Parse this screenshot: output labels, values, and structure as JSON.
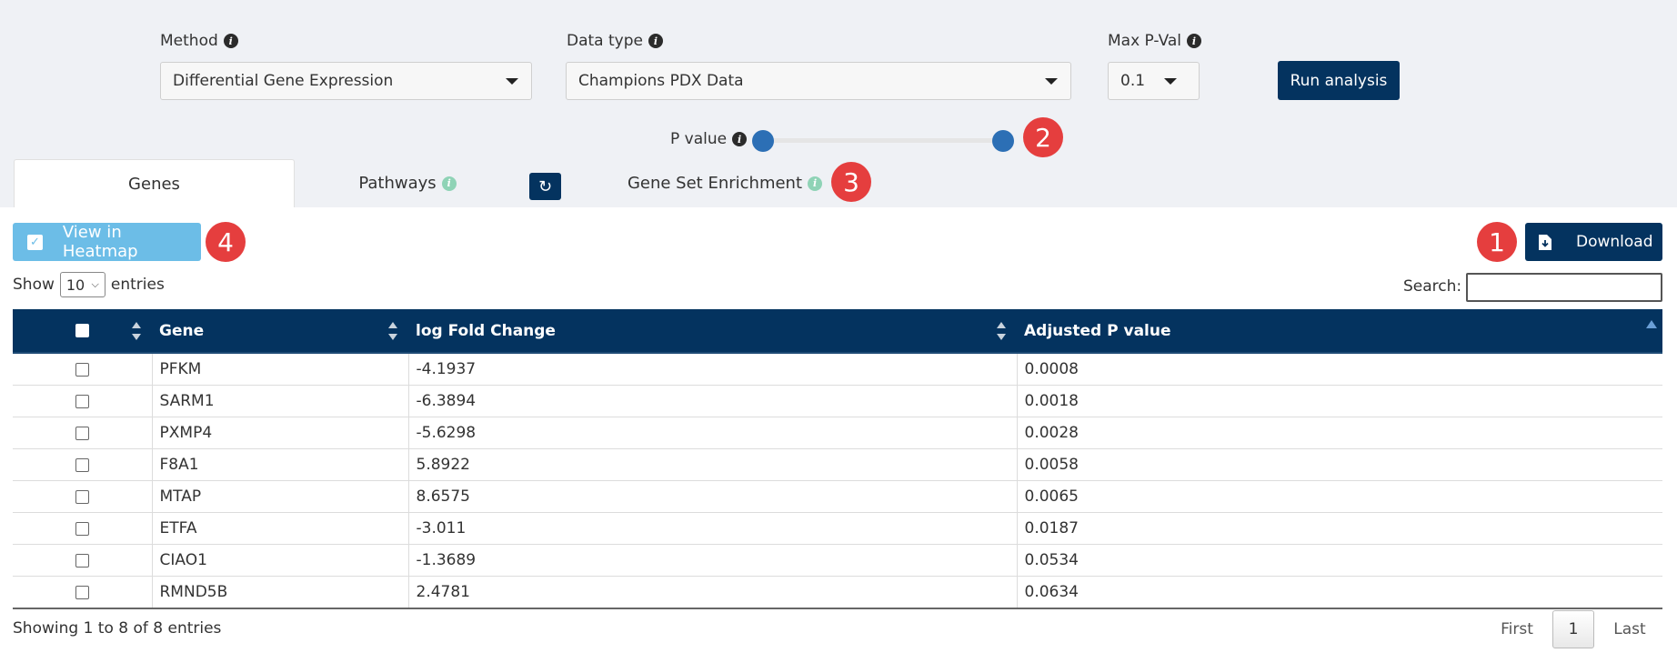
{
  "filters": {
    "method": {
      "label": "Method",
      "value": "Differential Gene Expression"
    },
    "data_type": {
      "label": "Data type",
      "value": "Champions PDX Data"
    },
    "max_pval": {
      "label": "Max P-Val",
      "value": "0.1"
    },
    "run_label": "Run analysis",
    "pvalue_label": "P value"
  },
  "badges": {
    "b1": "1",
    "b2": "2",
    "b3": "3",
    "b4": "4"
  },
  "tabs": [
    {
      "label": "Genes",
      "active": true
    },
    {
      "label": "Pathways",
      "active": false
    },
    {
      "label": "Gene Set Enrichment",
      "active": false
    }
  ],
  "toolbar": {
    "heatmap_label": "View in Heatmap",
    "download_label": "Download"
  },
  "table_controls": {
    "show": "Show",
    "entries_value": "10",
    "entries": "entries",
    "search_label": "Search:"
  },
  "table": {
    "headers": [
      "Gene",
      "log Fold Change",
      "Adjusted P value"
    ],
    "rows": [
      [
        "PFKM",
        "-4.1937",
        "0.0008"
      ],
      [
        "SARM1",
        "-6.3894",
        "0.0018"
      ],
      [
        "PXMP4",
        "-5.6298",
        "0.0028"
      ],
      [
        "F8A1",
        "5.8922",
        "0.0058"
      ],
      [
        "MTAP",
        "8.6575",
        "0.0065"
      ],
      [
        "ETFA",
        "-3.011",
        "0.0187"
      ],
      [
        "CIAO1",
        "-1.3689",
        "0.0534"
      ],
      [
        "RMND5B",
        "2.4781",
        "0.0634"
      ]
    ]
  },
  "pagination": {
    "info": "Showing 1 to 8 of 8 entries",
    "first": "First",
    "page": "1",
    "last": "Last"
  },
  "colors": {
    "navy": "#04335f",
    "badge_red": "#e53e3e",
    "heatmap_blue": "#6cbde7",
    "slider_blue": "#2c6fb5"
  },
  "icons": {
    "info": "info-icon",
    "refresh": "refresh-icon",
    "checkbox": "checkbox-icon",
    "download": "file-download-icon"
  }
}
